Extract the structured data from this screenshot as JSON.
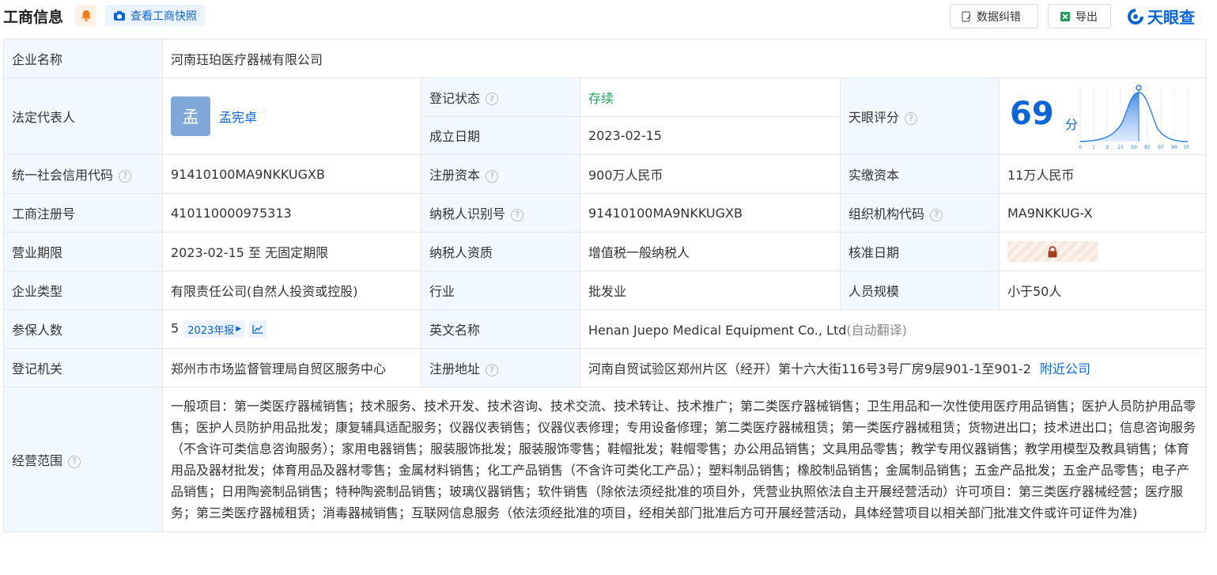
{
  "header": {
    "title": "工商信息",
    "snapshot_btn": "查看工商快照",
    "correct_btn": "数据纠错",
    "export_btn": "导出",
    "logo_text": "天眼查"
  },
  "fields": {
    "company_name_label": "企业名称",
    "company_name": "河南珏珀医疗器械有限公司",
    "legal_rep_label": "法定代表人",
    "legal_rep_avatar": "孟",
    "legal_rep_name": "孟宪卓",
    "reg_status_label": "登记状态",
    "reg_status": "存续",
    "found_date_label": "成立日期",
    "found_date": "2023-02-15",
    "tianyan_score_label": "天眼评分",
    "tianyan_score": "69",
    "score_unit": "分",
    "score_ticks": [
      "0",
      "1",
      "3",
      "15",
      "50",
      "85",
      "97",
      "99",
      "100"
    ],
    "credit_code_label": "统一社会信用代码",
    "credit_code": "91410100MA9NKKUGXB",
    "reg_capital_label": "注册资本",
    "reg_capital": "900万人民币",
    "paid_capital_label": "实缴资本",
    "paid_capital": "11万人民币",
    "reg_no_label": "工商注册号",
    "reg_no": "410110000975313",
    "taxpayer_id_label": "纳税人识别号",
    "taxpayer_id": "91410100MA9NKKUGXB",
    "org_code_label": "组织机构代码",
    "org_code": "MA9NKKUG-X",
    "term_label": "营业期限",
    "term": "2023-02-15 至 无固定期限",
    "taxpayer_qual_label": "纳税人资质",
    "taxpayer_qual": "增值税一般纳税人",
    "approve_date_label": "核准日期",
    "type_label": "企业类型",
    "type": "有限责任公司(自然人投资或控股)",
    "industry_label": "行业",
    "industry": "批发业",
    "staff_size_label": "人员规模",
    "staff_size": "小于50人",
    "insured_label": "参保人数",
    "insured": "5",
    "insured_badge": "2023年报",
    "english_name_label": "英文名称",
    "english_name": "Henan Juepo Medical Equipment Co., Ltd",
    "english_name_note": "(自动翻译)",
    "authority_label": "登记机关",
    "authority": "郑州市市场监督管理局自贸区服务中心",
    "address_label": "注册地址",
    "address": "河南自贸试验区郑州片区（经开）第十六大街116号3号厂房9层901-1至901-2",
    "nearby_link": "附近公司",
    "scope_label": "经营范围",
    "scope": "一般项目：第一类医疗器械销售；技术服务、技术开发、技术咨询、技术交流、技术转让、技术推广；第二类医疗器械销售；卫生用品和一次性使用医疗用品销售；医护人员防护用品零售；医护人员防护用品批发；康复辅具适配服务；仪器仪表销售；仪器仪表修理；专用设备修理；第二类医疗器械租赁；第一类医疗器械租赁；货物进出口；技术进出口；信息咨询服务（不含许可类信息咨询服务）；家用电器销售；服装服饰批发；服装服饰零售；鞋帽批发；鞋帽零售；办公用品销售；文具用品零售；教学专用仪器销售；教学用模型及教具销售；体育用品及器材批发；体育用品及器材零售；金属材料销售；化工产品销售（不含许可类化工产品）；塑料制品销售；橡胶制品销售；金属制品销售；五金产品批发；五金产品零售；电子产品销售；日用陶瓷制品销售；特种陶瓷制品销售；玻璃仪器销售；软件销售（除依法须经批准的项目外，凭营业执照依法自主开展经营活动）许可项目：第三类医疗器械经营；医疗服务；第三类医疗器械租赁；消毒器械销售；互联网信息服务（依法须经批准的项目，经相关部门批准后方可开展经营活动，具体经营项目以相关部门批准文件或许可证件为准)"
  },
  "colors": {
    "accent": "#0a66d8",
    "label_bg": "#f2f8ff",
    "status_green": "#23a55a"
  }
}
